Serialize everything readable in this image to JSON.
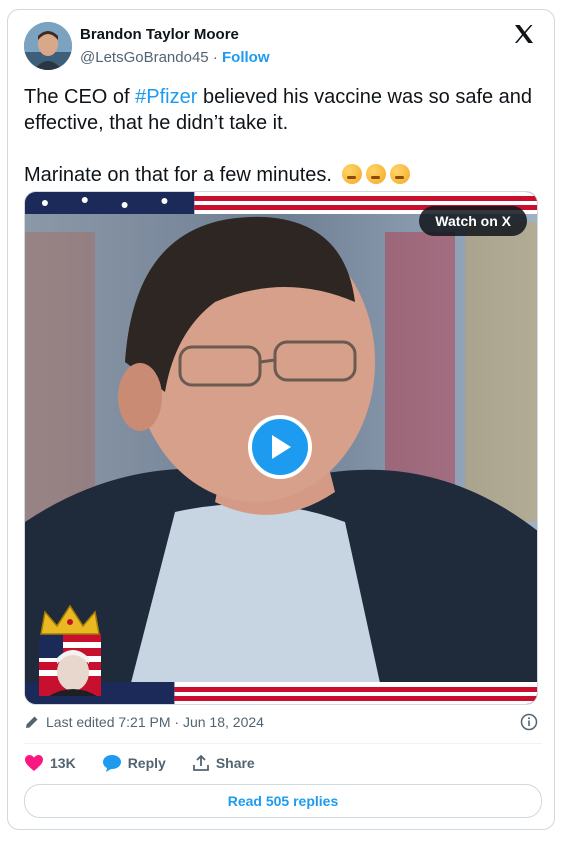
{
  "author": {
    "name": "Brandon Taylor Moore",
    "handle": "@LetsGoBrando45",
    "separator": "·",
    "follow_label": "Follow"
  },
  "tweet": {
    "line1_prefix": "The CEO of ",
    "hashtag": "#Pfizer",
    "line1_suffix": " believed his vaccine was so safe and effective, that he didn’t take it.",
    "line2": "Marinate on that for a few minutes."
  },
  "media": {
    "watch_label": "Watch on X"
  },
  "meta": {
    "edited_text": "Last edited 7:21 PM · Jun 18, 2024"
  },
  "actions": {
    "like_count": "13K",
    "reply_label": "Reply",
    "share_label": "Share"
  },
  "replies_button": "Read 505 replies",
  "colors": {
    "accent": "#1d9bf0",
    "like": "#f91880",
    "border": "#cfd9de"
  }
}
